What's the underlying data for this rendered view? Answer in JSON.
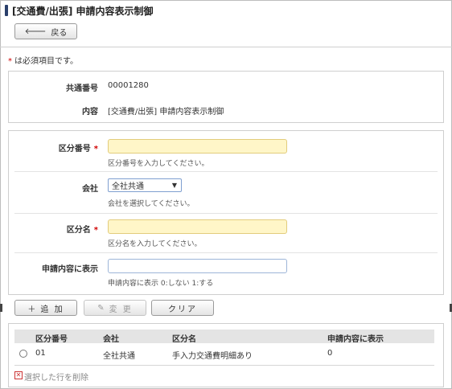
{
  "title": "[交通費/出張] 申請内容表示制御",
  "back_button": "戻る",
  "required_note": "は必須項目です。",
  "required_mark": "*",
  "info": {
    "rows": [
      {
        "label": "共通番号",
        "value": "00001280"
      },
      {
        "label": "内容",
        "value": "[交通費/出張] 申請内容表示制御"
      }
    ]
  },
  "form": {
    "category_no": {
      "label": "区分番号",
      "value": "",
      "hint": "区分番号を入力してください。"
    },
    "company": {
      "label": "会社",
      "selected": "全社共通",
      "hint": "会社を選択してください。"
    },
    "category_name": {
      "label": "区分名",
      "value": "",
      "hint": "区分名を入力してください。"
    },
    "display_flag": {
      "label": "申請内容に表示",
      "value": "",
      "hint": "申請内容に表示 0:しない 1:する"
    }
  },
  "actions": {
    "add": "追 加",
    "edit": "変 更",
    "clear": "クリア"
  },
  "table": {
    "headers": [
      "区分番号",
      "会社",
      "区分名",
      "申請内容に表示"
    ],
    "rows": [
      {
        "no": "01",
        "company": "全社共通",
        "name": "手入力交通費明細あり",
        "display": "0"
      }
    ]
  },
  "delete_selected": "選択した行を削除",
  "colors": {
    "title_mark": "#2a3f6b",
    "required_star": "#d00000",
    "required_input_bg": "#fff6c8",
    "table_header_bg": "#e4e4e4"
  }
}
